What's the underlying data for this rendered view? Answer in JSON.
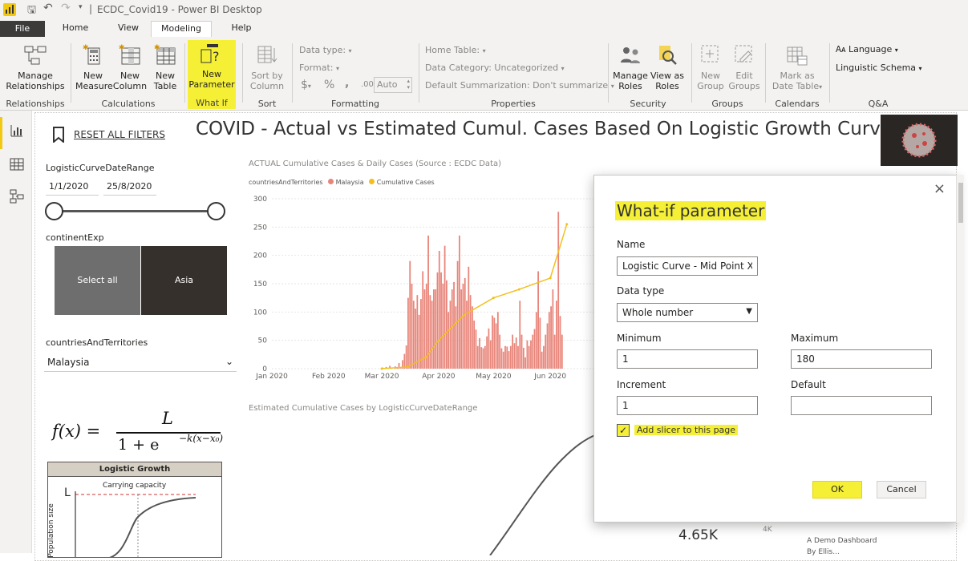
{
  "titlebar": {
    "doc_title": "ECDC_Covid19 - Power BI Desktop",
    "separator": "|"
  },
  "menu": {
    "tabs": [
      "File",
      "Home",
      "View",
      "Modeling",
      "Help"
    ],
    "active": "Modeling"
  },
  "ribbon": {
    "manage_relationships": "Manage Relationships",
    "group_relationships": "Relationships",
    "new_measure": "New Measure",
    "new_column": "New Column",
    "new_table": "New Table",
    "group_calculations": "Calculations",
    "new_parameter": "New Parameter",
    "group_whatif": "What If",
    "sort_by_column": "Sort by Column",
    "group_sort": "Sort",
    "data_type": "Data type:",
    "format": "Format:",
    "currency": "$",
    "percent": "%",
    "comma": ",",
    "decimals": ".00",
    "auto": "Auto",
    "group_formatting": "Formatting",
    "home_table": "Home Table:",
    "data_category": "Data Category: Uncategorized",
    "default_summarization": "Default Summarization: Don't summarize",
    "group_properties": "Properties",
    "manage_roles": "Manage Roles",
    "view_as_roles": "View as Roles",
    "group_security": "Security",
    "new_group": "New Group",
    "edit_groups": "Edit Groups",
    "group_groups": "Groups",
    "mark_as_date_table": "Mark as Date Table",
    "group_calendars": "Calendars",
    "language": "Language",
    "linguistic_schema": "Linguistic Schema",
    "group_qa": "Q&A"
  },
  "report": {
    "title": "COVID - Actual vs Estimated Cumul. Cases Based On Logistic Growth Curve",
    "reset_filters": "RESET ALL FILTERS",
    "date_slicer": {
      "label": "LogisticCurveDateRange",
      "start": "1/1/2020",
      "end": "25/8/2020"
    },
    "continent_slicer": {
      "label": "continentExp",
      "options": [
        "Select all",
        "Asia"
      ]
    },
    "country_slicer": {
      "label": "countriesAndTerritories",
      "value": "Malaysia"
    },
    "formula": {
      "lhs": "f(x) =",
      "numerator": "L",
      "denominator": "1 + e",
      "exponent": "−k(x−x₀)"
    },
    "logistic_image": {
      "title": "Logistic Growth",
      "carrying": "Carrying capacity",
      "L": "L",
      "ylabel": "Population size"
    },
    "kpi": "4.65K",
    "kpi_axis": "4K",
    "footer": [
      "A Demo Dashboard",
      "By Ellis..."
    ]
  },
  "chart_title_1": "ACTUAL Cumulative Cases & Daily Cases (Source : ECDC Data)",
  "legend_1": {
    "field": "countriesAndTerritories",
    "items": [
      "Malaysia",
      "Cumulative Cases"
    ],
    "colors": [
      "#e8857a",
      "#f2c01e"
    ]
  },
  "chart_title_2": "Estimated Cumulative Cases by LogisticCurveDateRange",
  "chart_data": [
    {
      "type": "bar",
      "title": "ACTUAL Cumulative Cases & Daily Cases (Source : ECDC Data)",
      "x_ticks": [
        "Jan 2020",
        "Feb 2020",
        "Mar 2020",
        "Apr 2020",
        "May 2020",
        "Jun 2020"
      ],
      "y_ticks": [
        0,
        50,
        100,
        150,
        200,
        250,
        300
      ],
      "ylim": [
        0,
        300
      ],
      "series": [
        {
          "name": "Malaysia",
          "kind": "bar",
          "x_start": "2020-03-01",
          "values": [
            2,
            0,
            3,
            1,
            5,
            2,
            0,
            4,
            2,
            10,
            1,
            15,
            26,
            41,
            125,
            190,
            150,
            120,
            106,
            130,
            95,
            123,
            172,
            140,
            150,
            235,
            130,
            120,
            140,
            140,
            170,
            208,
            170,
            150,
            217,
            156,
            100,
            120,
            140,
            153,
            110,
            190,
            235,
            140,
            150,
            160,
            120,
            180,
            130,
            110,
            85,
            69,
            40,
            54,
            38,
            36,
            40,
            57,
            71,
            50,
            94,
            90,
            80,
            100,
            60,
            36,
            30,
            40,
            39,
            31,
            40,
            60,
            45,
            55,
            40,
            120,
            60,
            37,
            20,
            50,
            40,
            50,
            60,
            70,
            100,
            172,
            90,
            30,
            40,
            60,
            80,
            100,
            110,
            140,
            60,
            120,
            277,
            93,
            60
          ]
        },
        {
          "name": "Cumulative Cases",
          "kind": "line",
          "x": [
            "2020-03-01",
            "2020-03-15",
            "2020-03-25",
            "2020-04-01",
            "2020-04-15",
            "2020-05-01",
            "2020-05-15",
            "2020-06-01",
            "2020-06-10"
          ],
          "values": [
            0,
            3,
            20,
            50,
            95,
            125,
            140,
            160,
            255
          ]
        }
      ]
    },
    {
      "type": "line",
      "title": "Estimated Cumulative Cases by LogisticCurveDateRange",
      "series": [
        {
          "name": "Estimated Cumulative Cases",
          "values": []
        }
      ]
    }
  ],
  "dialog": {
    "title": "What-if parameter",
    "name_label": "Name",
    "name_value": "Logistic Curve - Mid Point Xo",
    "datatype_label": "Data type",
    "datatype_value": "Whole number",
    "min_label": "Minimum",
    "min_value": "1",
    "max_label": "Maximum",
    "max_value": "180",
    "inc_label": "Increment",
    "inc_value": "1",
    "default_label": "Default",
    "default_value": "",
    "add_slicer": "Add slicer to this page",
    "add_slicer_checked": true,
    "ok": "OK",
    "cancel": "Cancel"
  },
  "colors": {
    "highlight": "#f5f036",
    "bar": "#e8857a",
    "line": "#f2c01e",
    "pbi_yellow": "#f2c811"
  }
}
